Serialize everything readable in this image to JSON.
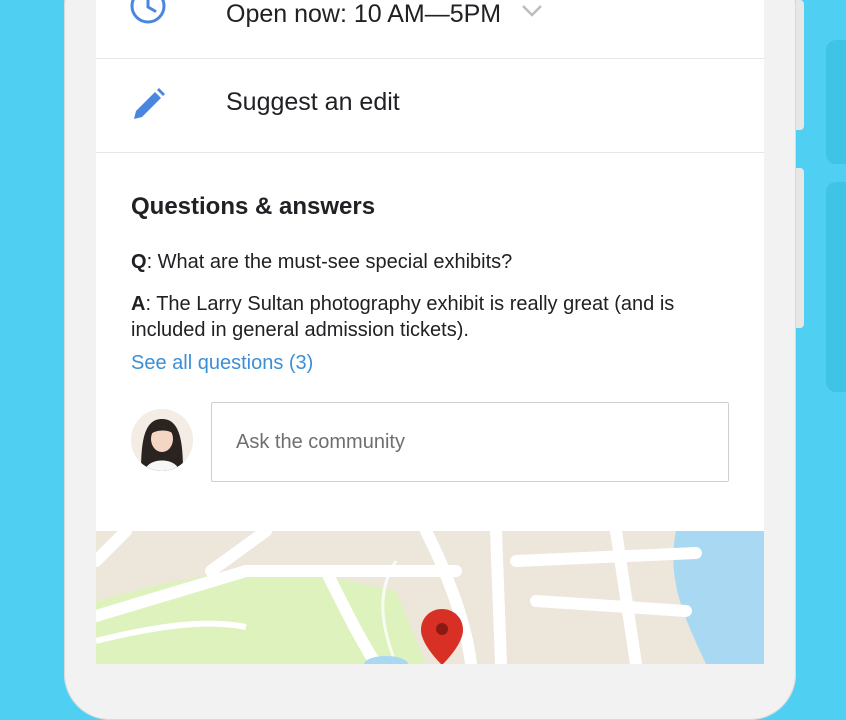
{
  "place": {
    "hours": {
      "label": "Open now: 10 AM—5PM"
    },
    "edit": {
      "label": "Suggest an edit"
    }
  },
  "qa": {
    "title": "Questions & answers",
    "question": {
      "prefix": "Q",
      "text": ": What are the must-see special exhibits?"
    },
    "answer": {
      "prefix": "A",
      "text": ": The Larry Sultan photography exhibit is really great (and is included in general admission tickets)."
    },
    "see_all": "See all questions (3)",
    "ask_placeholder": "Ask the community"
  },
  "icons": {
    "hours": "clock-icon",
    "expand": "chevron-down-icon",
    "edit": "pencil-icon",
    "marker": "map-pin-icon"
  },
  "colors": {
    "accent": "#4a86e0",
    "link": "#3b8fd8",
    "pin": "#d93025",
    "background": "#4fd0f2",
    "map_land": "#ece6db",
    "map_park": "#ddf2bd",
    "map_water": "#a9d8f3"
  }
}
